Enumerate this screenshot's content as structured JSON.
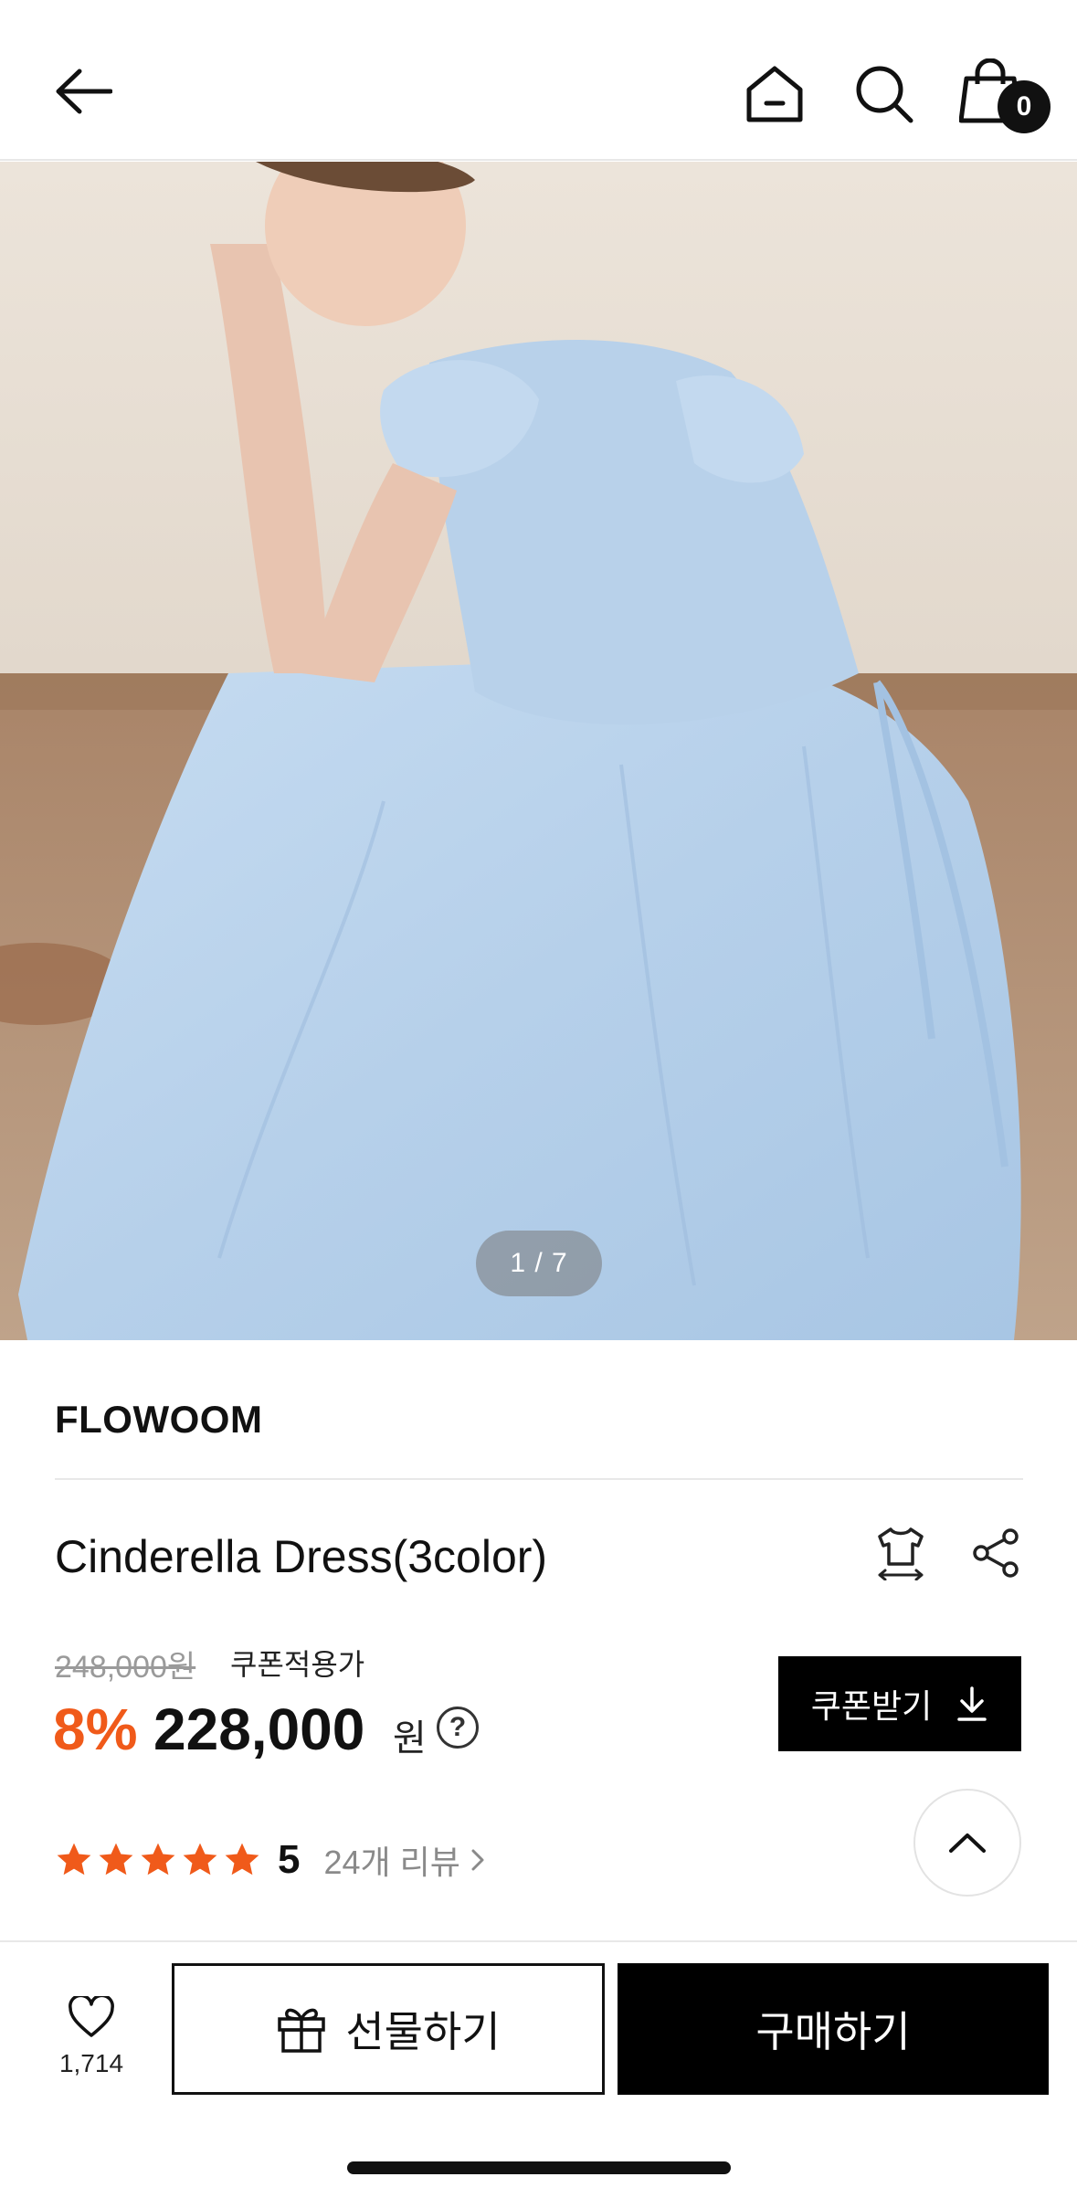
{
  "header": {
    "back_icon": "arrow-left-icon",
    "home_icon": "home-icon",
    "search_icon": "search-icon",
    "cart_icon": "shopping-bag-icon",
    "cart_count": "0"
  },
  "gallery": {
    "pager": "1 / 7",
    "image_alt": "product-photo"
  },
  "product": {
    "brand": "FLOWOOM",
    "title": "Cinderella Dress(3color)",
    "original_price": "248,000원",
    "coupon_note": "쿠폰적용가",
    "discount": "8%",
    "price": "228,000",
    "currency": "원",
    "help": "?",
    "coupon_button": "쿠폰받기",
    "rating": "5",
    "star_count": 5,
    "review_link": "24개 리뷰"
  },
  "bottom": {
    "like_count": "1,714",
    "gift_button": "선물하기",
    "buy_button": "구매하기"
  },
  "colors": {
    "accent_orange": "#f05a1a",
    "black": "#000000",
    "dress_blue": "#b9d3ec"
  }
}
